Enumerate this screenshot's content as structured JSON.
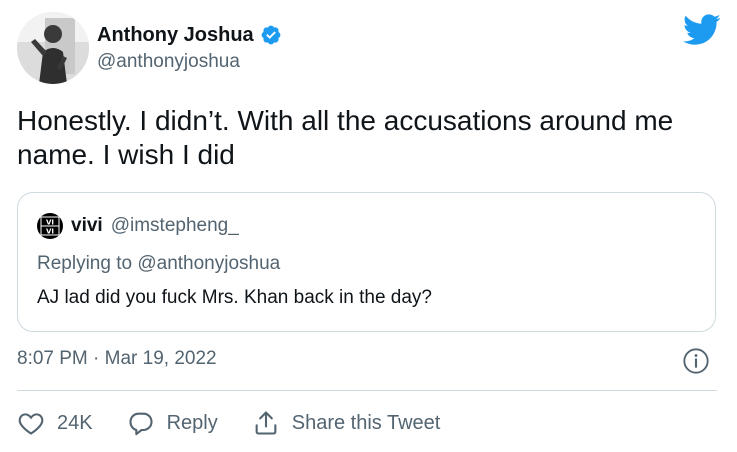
{
  "author": {
    "display_name": "Anthony Joshua",
    "handle": "@anthonyjoshua",
    "verified_icon": "verified-badge-icon"
  },
  "tweet": {
    "text": "Honestly. I didn’t. With all the accusations around me name. I wish I did",
    "timestamp": "8:07 PM · Mar 19, 2022"
  },
  "quoted_tweet": {
    "display_name": "vivi",
    "handle": "@imstepheng_",
    "avatar_text": "VI VI",
    "replying_to": "Replying to @anthonyjoshua",
    "text": "AJ lad did you fuck Mrs. Khan back in the day?"
  },
  "actions": {
    "like_count": "24K",
    "reply_label": "Reply",
    "share_label": "Share this Tweet"
  },
  "colors": {
    "brand_blue": "#1d9bf0",
    "secondary_text": "#536471",
    "border": "#cfd9de"
  }
}
